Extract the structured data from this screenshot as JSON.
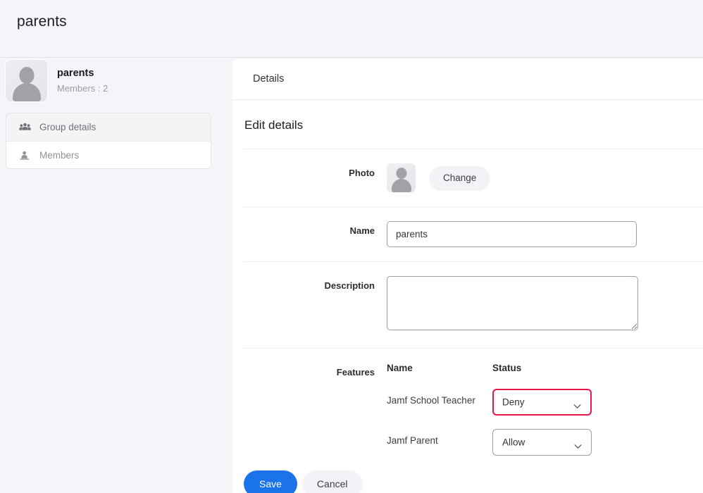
{
  "header": {
    "title": "parents"
  },
  "sidebar": {
    "group": {
      "name": "parents",
      "members_label": "Members : 2",
      "avatar_icon": "user-silhouette-icon"
    },
    "items": [
      {
        "label": "Group details",
        "icon": "users-group-icon",
        "active": true
      },
      {
        "label": "Members",
        "icon": "user-person-icon",
        "active": false
      }
    ]
  },
  "panel": {
    "tab_label": "Details",
    "section_title": "Edit details",
    "photo": {
      "label": "Photo",
      "avatar_icon": "user-silhouette-icon",
      "change_label": "Change"
    },
    "name": {
      "label": "Name",
      "value": "parents",
      "placeholder": ""
    },
    "description": {
      "label": "Description",
      "value": "",
      "placeholder": ""
    },
    "features": {
      "label": "Features",
      "columns": [
        "Name",
        "Status"
      ],
      "rows": [
        {
          "name": "Jamf School Teacher",
          "status": "Deny",
          "danger": true
        },
        {
          "name": "Jamf Parent",
          "status": "Allow",
          "danger": false
        }
      ],
      "status_options": [
        "Allow",
        "Deny"
      ]
    }
  },
  "footer": {
    "save_label": "Save",
    "cancel_label": "Cancel"
  },
  "colors": {
    "page_bg": "#f4f5f8",
    "panel_bg": "#ffffff",
    "accent_blue": "#1a73e8",
    "danger_red": "#e8174a",
    "text_primary": "#1b1d21",
    "text_muted": "#9a9da3",
    "border": "#e3e6ea"
  }
}
